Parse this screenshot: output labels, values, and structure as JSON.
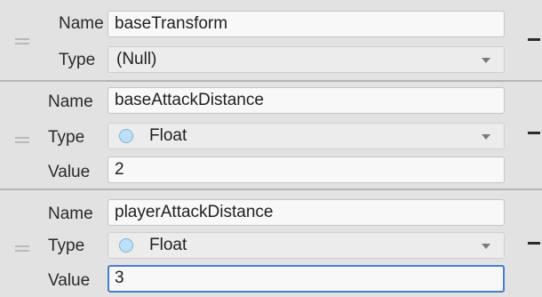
{
  "labels": {
    "name": "Name",
    "type": "Type",
    "value": "Value"
  },
  "variables": [
    {
      "name": "baseTransform",
      "type": "(Null)",
      "type_icon": null
    },
    {
      "name": "baseAttackDistance",
      "type": "Float",
      "type_icon": "float-circle-icon",
      "value": "2"
    },
    {
      "name": "playerAttackDistance",
      "type": "Float",
      "type_icon": "float-circle-icon",
      "value": "3",
      "focused": true
    }
  ],
  "colors": {
    "float_icon": "#bde0f6",
    "focus_border": "#4a7bd0"
  }
}
